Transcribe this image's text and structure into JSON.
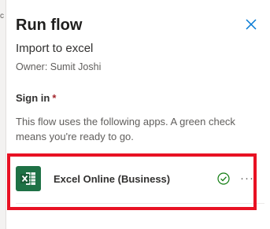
{
  "left_strip": {
    "peek_text": "c"
  },
  "panel": {
    "title": "Run flow",
    "close_icon": "close-icon",
    "flow_name": "Import to excel",
    "owner": "Owner: Sumit Joshi",
    "signin_label": "Sign in",
    "required_mark": "*",
    "description": "This flow uses the following apps. A green check means you're ready to go.",
    "connection": {
      "icon": "excel-icon",
      "label": "Excel Online (Business)",
      "status_icon": "check-circle-icon",
      "more_label": "···"
    }
  },
  "colors": {
    "accent": "#0078d4",
    "excel_green": "#1e7145",
    "check_green": "#107c10",
    "required_red": "#a4262c",
    "highlight_red": "#e81123"
  }
}
